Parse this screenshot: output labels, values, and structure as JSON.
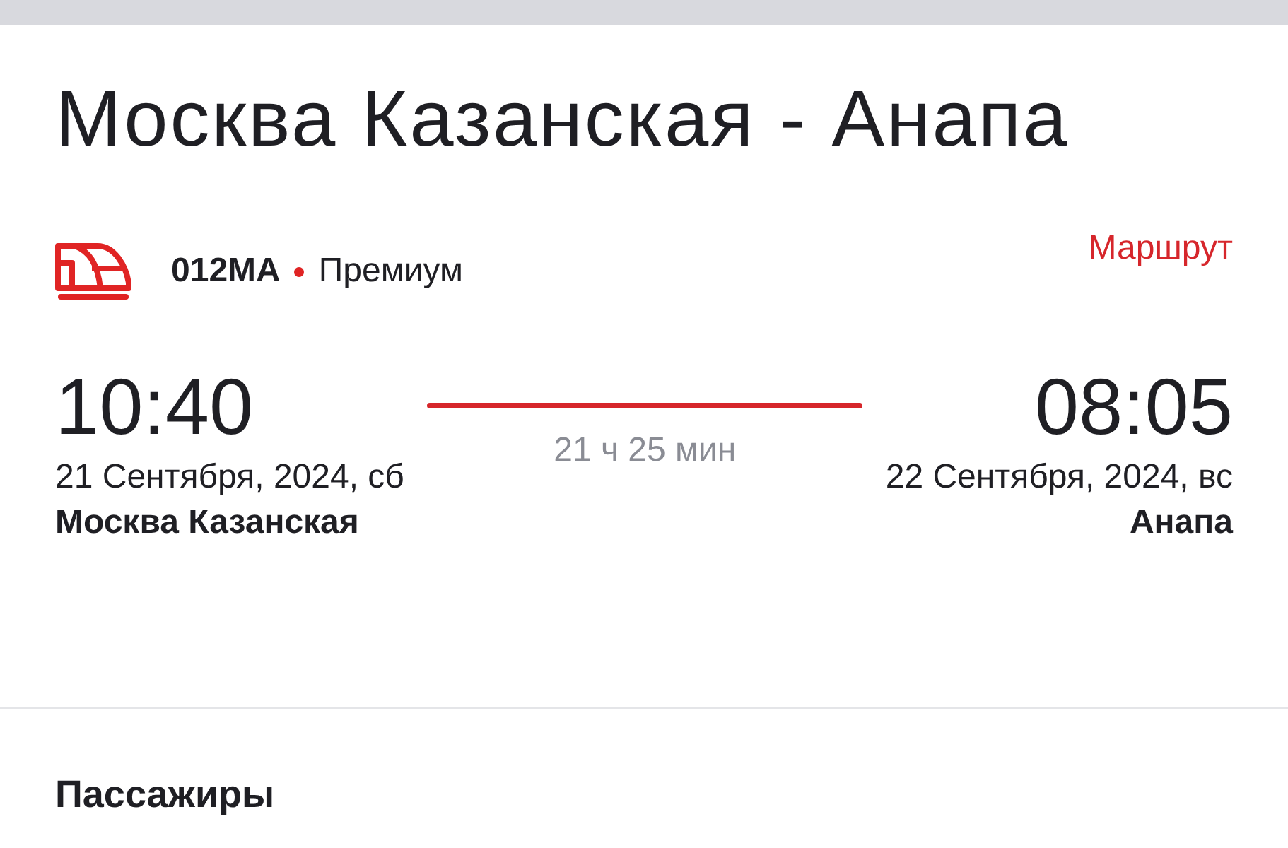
{
  "title": "Москва Казанская - Анапа",
  "train": {
    "number": "012МА",
    "class": "Премиум",
    "route_link": "Маршрут"
  },
  "departure": {
    "time": "10:40",
    "date": "21 Сентября, 2024, сб",
    "station": "Москва Казанская"
  },
  "duration": "21 ч 25 мин",
  "arrival": {
    "time": "08:05",
    "date": "22 Сентября, 2024, вс",
    "station": "Анапа"
  },
  "passengers": {
    "heading": "Пассажиры"
  }
}
